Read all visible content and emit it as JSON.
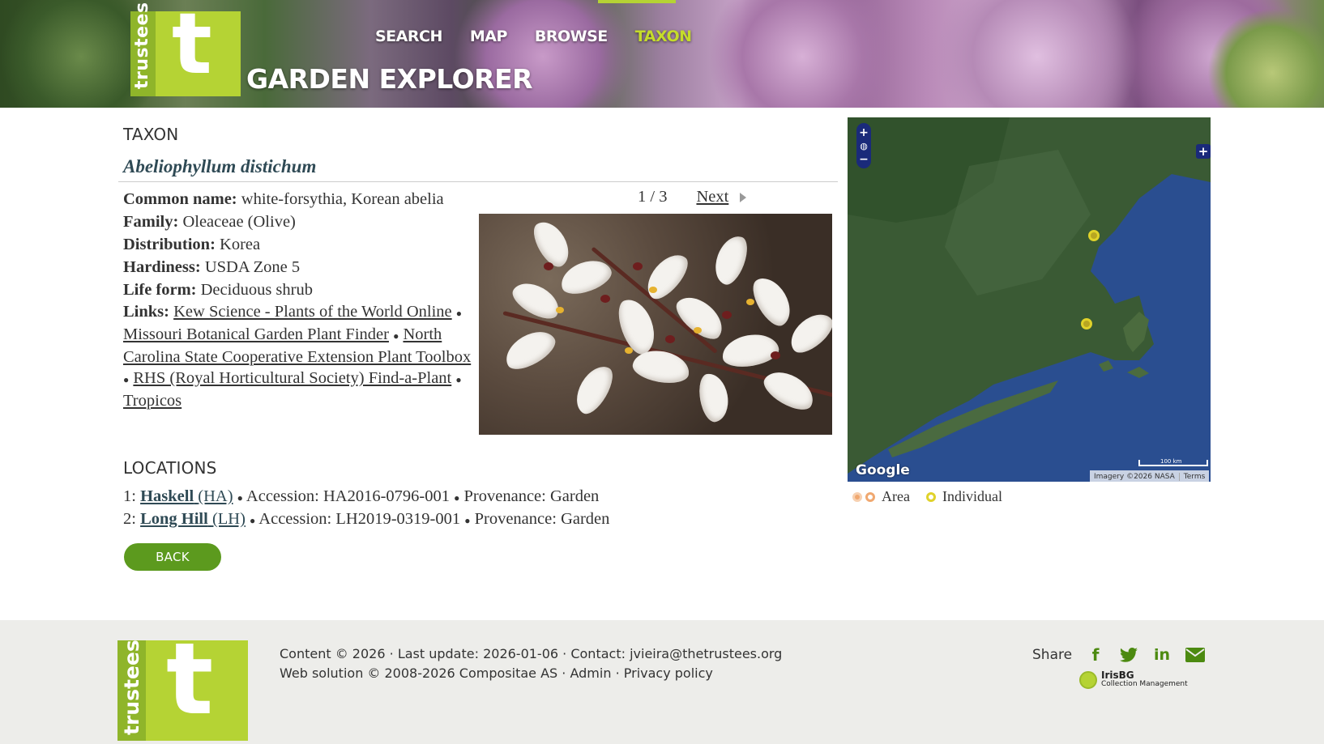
{
  "header": {
    "brand_vertical": "trustees",
    "brand_letter": "t",
    "app_title": "GARDEN EXPLORER",
    "nav": [
      {
        "label": "SEARCH",
        "active": false
      },
      {
        "label": "MAP",
        "active": false
      },
      {
        "label": "BROWSE",
        "active": false
      },
      {
        "label": "TAXON",
        "active": true
      }
    ]
  },
  "taxon": {
    "section_title": "TAXON",
    "scientific_name": "Abeliophyllum distichum",
    "common_name_label": "Common name:",
    "common_name": "white-forsythia, Korean abelia",
    "family_label": "Family:",
    "family": "Oleaceae (Olive)",
    "distribution_label": "Distribution:",
    "distribution": "Korea",
    "hardiness_label": "Hardiness:",
    "hardiness": "USDA Zone 5",
    "life_form_label": "Life form:",
    "life_form": "Deciduous shrub",
    "links_label": "Links:",
    "links": [
      "Kew Science - Plants of the World Online",
      "Missouri Botanical Garden Plant Finder",
      "North Carolina State Cooperative Extension Plant Toolbox",
      "RHS (Royal Horticultural Society) Find-a-Plant",
      "Tropicos"
    ],
    "link_separator": "●"
  },
  "pager": {
    "count": "1 / 3",
    "next_label": "Next"
  },
  "locations": {
    "section_title": "LOCATIONS",
    "rows": [
      {
        "index": "1:",
        "name": "Haskell",
        "code": "(HA)",
        "accession_label": "Accession:",
        "accession": "HA2016-0796-001",
        "provenance_label": "Provenance:",
        "provenance": "Garden"
      },
      {
        "index": "2:",
        "name": "Long Hill",
        "code": "(LH)",
        "accession_label": "Accession:",
        "accession": "LH2019-0319-001",
        "provenance_label": "Provenance:",
        "provenance": "Garden"
      }
    ],
    "separator": "●"
  },
  "back_label": "BACK",
  "map": {
    "zoom_in": "+",
    "zoom_out": "−",
    "expand": "+",
    "google": "Google",
    "scale_label": "100 km",
    "imagery": "Imagery ©2026 NASA",
    "terms": "Terms",
    "legend_area": "Area",
    "legend_individual": "Individual",
    "colors": {
      "water": "#2a4e90",
      "land": "#3a5a34",
      "marker": "#e0d22a",
      "area": "#f0a870"
    }
  },
  "footer": {
    "brand_vertical": "trustees",
    "brand_letter": "t",
    "line1_content": "Content © 2026",
    "line1_update": "Last update: 2026-01-06",
    "line1_contact_label": "Contact:",
    "line1_contact": "jvieira@thetrustees.org",
    "line2_web": "Web solution © 2008-2026 Compositae AS",
    "line2_admin": "Admin",
    "line2_privacy": "Privacy policy",
    "dot": "·",
    "share_label": "Share",
    "share_icons": [
      "facebook-icon",
      "twitter-icon",
      "linkedin-icon",
      "email-icon"
    ],
    "iris_title": "IrisBG",
    "iris_subtitle": "Collection Management"
  },
  "colors": {
    "brand_green": "#b5d334",
    "button_green": "#5c9a1e",
    "active_nav": "#c5dc2a"
  }
}
